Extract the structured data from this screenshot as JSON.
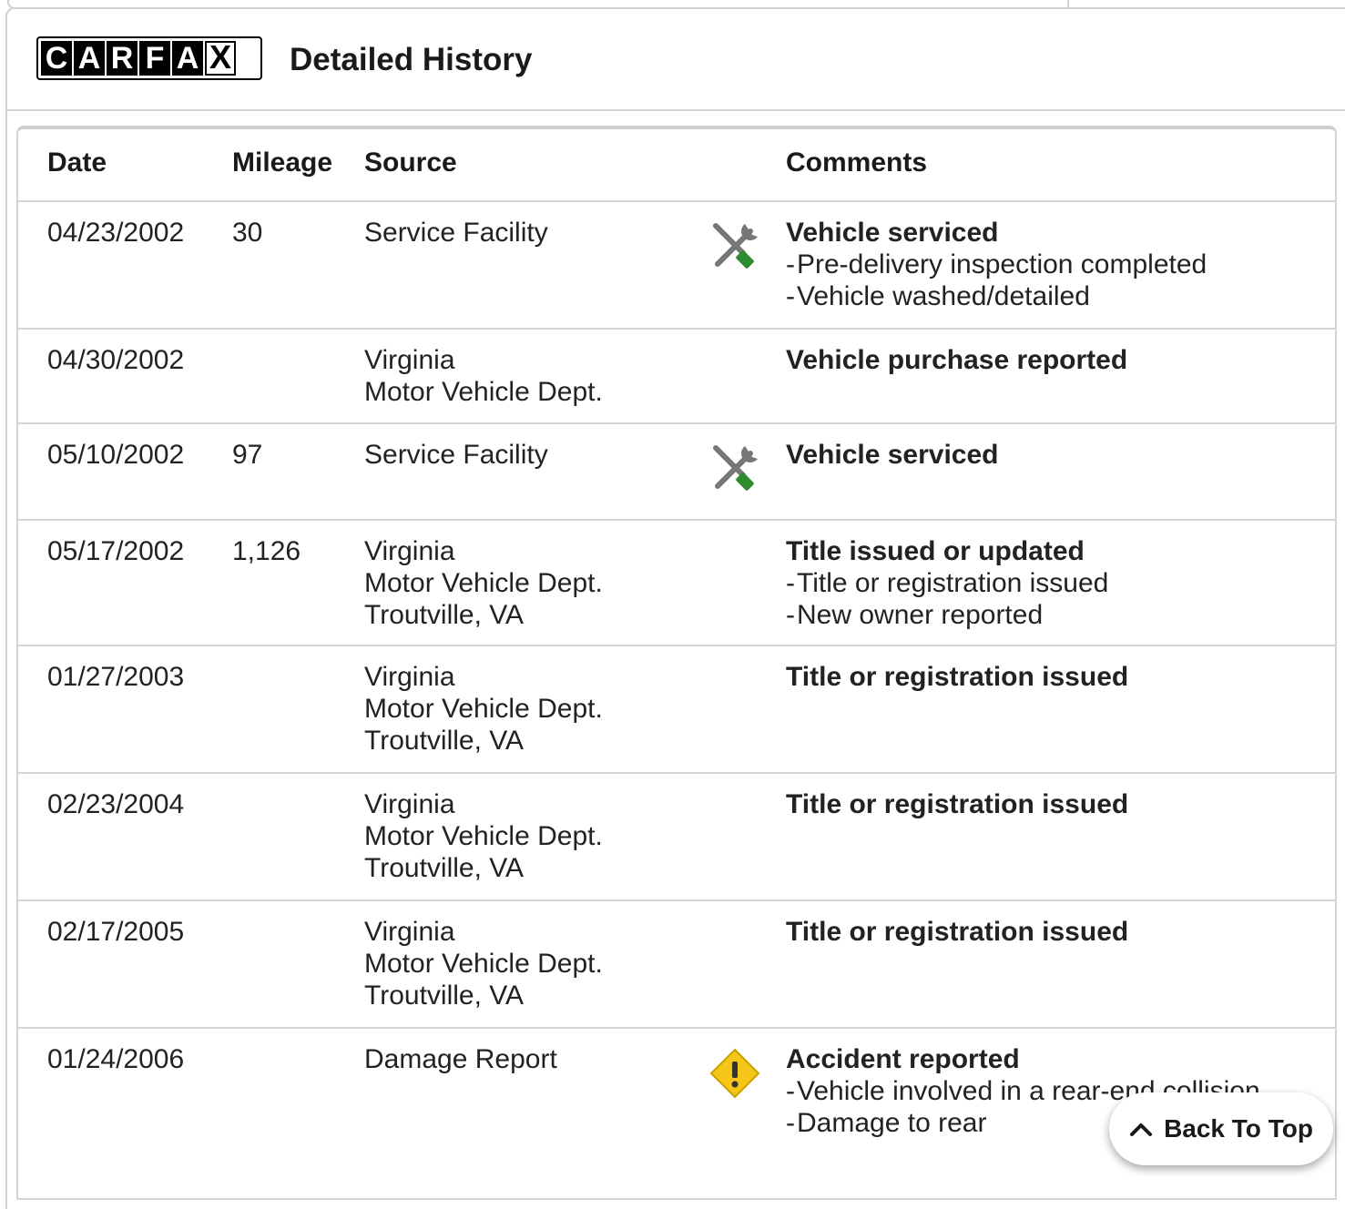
{
  "header": {
    "logo_letters": [
      "C",
      "A",
      "R",
      "F",
      "A",
      "X"
    ],
    "title": "Detailed History"
  },
  "columns": {
    "date": "Date",
    "mileage": "Mileage",
    "source": "Source",
    "comments": "Comments"
  },
  "rows": [
    {
      "date": "04/23/2002",
      "mileage": "30",
      "source": [
        "Service Facility"
      ],
      "icon": "service-icon",
      "comment_title": "Vehicle serviced",
      "comment_items": [
        "Pre-delivery inspection completed",
        "Vehicle washed/detailed"
      ]
    },
    {
      "date": "04/30/2002",
      "mileage": "",
      "source": [
        "Virginia",
        "Motor Vehicle Dept."
      ],
      "icon": "",
      "comment_title": "Vehicle purchase reported",
      "comment_items": []
    },
    {
      "date": "05/10/2002",
      "mileage": "97",
      "source": [
        "Service Facility"
      ],
      "icon": "service-icon",
      "comment_title": "Vehicle serviced",
      "comment_items": []
    },
    {
      "date": "05/17/2002",
      "mileage": "1,126",
      "source": [
        "Virginia",
        "Motor Vehicle Dept.",
        "Troutville, VA"
      ],
      "icon": "",
      "comment_title": "Title issued or updated",
      "comment_items": [
        "Title or registration issued",
        "New owner reported"
      ]
    },
    {
      "date": "01/27/2003",
      "mileage": "",
      "source": [
        "Virginia",
        "Motor Vehicle Dept.",
        "Troutville, VA"
      ],
      "icon": "",
      "comment_title": "Title or registration issued",
      "comment_items": []
    },
    {
      "date": "02/23/2004",
      "mileage": "",
      "source": [
        "Virginia",
        "Motor Vehicle Dept.",
        "Troutville, VA"
      ],
      "icon": "",
      "comment_title": "Title or registration issued",
      "comment_items": []
    },
    {
      "date": "02/17/2005",
      "mileage": "",
      "source": [
        "Virginia",
        "Motor Vehicle Dept.",
        "Troutville, VA"
      ],
      "icon": "",
      "comment_title": "Title or registration issued",
      "comment_items": []
    },
    {
      "date": "01/24/2006",
      "mileage": "",
      "source": [
        "Damage Report"
      ],
      "icon": "warning-icon",
      "comment_title": "Accident reported",
      "comment_items": [
        "Vehicle involved in a rear-end collision",
        "Damage to rear"
      ]
    }
  ],
  "back_to_top": {
    "label": "Back To Top",
    "icon": "chevron-up-icon"
  },
  "colors": {
    "service_green": "#2e8b2e",
    "warning_yellow": "#f5c518",
    "border": "#d4d4d4"
  }
}
